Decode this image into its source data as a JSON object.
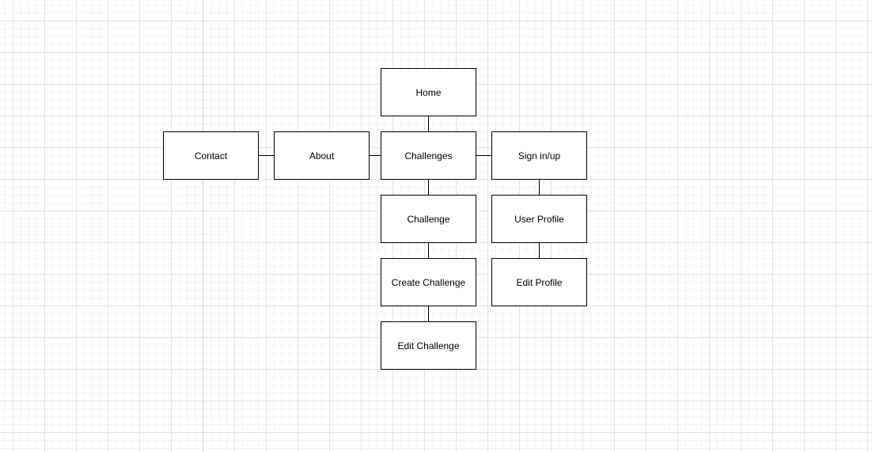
{
  "diagram": {
    "nodes": [
      {
        "id": "home",
        "label": "Home"
      },
      {
        "id": "contact",
        "label": "Contact"
      },
      {
        "id": "about",
        "label": "About"
      },
      {
        "id": "challenges",
        "label": "Challenges"
      },
      {
        "id": "signin",
        "label": "Sign in/up"
      },
      {
        "id": "challenge",
        "label": "Challenge"
      },
      {
        "id": "user_profile",
        "label": "User Profile"
      },
      {
        "id": "create_challenge",
        "label": "Create Challenge"
      },
      {
        "id": "edit_profile",
        "label": "Edit Profile"
      },
      {
        "id": "edit_challenge",
        "label": "Edit Challenge"
      }
    ],
    "edges": [
      {
        "from": "home",
        "to": "challenges"
      },
      {
        "from": "contact",
        "to": "about"
      },
      {
        "from": "about",
        "to": "challenges"
      },
      {
        "from": "challenges",
        "to": "signin"
      },
      {
        "from": "challenges",
        "to": "challenge"
      },
      {
        "from": "challenge",
        "to": "create_challenge"
      },
      {
        "from": "create_challenge",
        "to": "edit_challenge"
      },
      {
        "from": "signin",
        "to": "user_profile"
      },
      {
        "from": "user_profile",
        "to": "edit_profile"
      }
    ]
  },
  "colors": {
    "background": "#ffffff",
    "grid_major": "#e2e2e2",
    "grid_minor": "#f3f3f3",
    "node_border": "#000000",
    "node_fill": "#ffffff",
    "edge": "#000000",
    "text": "#000000"
  }
}
